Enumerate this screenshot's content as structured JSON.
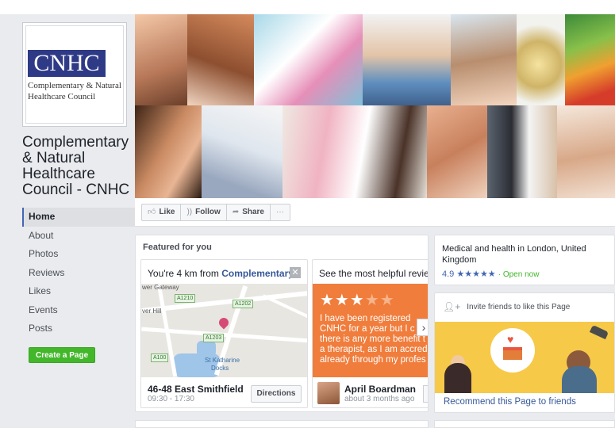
{
  "page": {
    "logo_text": "CNHC",
    "logo_subtitle": "Complementary & Natural\nHealthcare Council",
    "name": "Complementary\n& Natural\nHealthcare\nCouncil - CNHC"
  },
  "nav": {
    "items": [
      "Home",
      "About",
      "Photos",
      "Reviews",
      "Likes",
      "Events",
      "Posts"
    ],
    "create_page": "Create a Page"
  },
  "actions": {
    "like": "Like",
    "follow": "Follow",
    "share": "Share",
    "more": "···"
  },
  "featured": {
    "title": "Featured for you",
    "location": {
      "heading_prefix": "You're 4 km from ",
      "heading_bold": "Complementary...",
      "address": "46-48 East Smithfield",
      "hours": "09:30 - 17:30",
      "button": "Directions",
      "map_labels": {
        "gateway": "wer Gateway",
        "hill": "ver Hill",
        "dock1": "St Katharine",
        "dock2": "Docks",
        "r1": "A1210",
        "r2": "A1202",
        "r3": "A1203",
        "r4": "A100"
      }
    },
    "review": {
      "heading": "See the most helpful reviews o",
      "rating": 3,
      "max_rating": 5,
      "text": "I have been registered\nCNHC for a year but I c\nthere is any more benefit t\na therapist, as I am accred\nalready through my profes",
      "author": "April Boardman",
      "time": "about 3 months ago"
    }
  },
  "info": {
    "category": "Medical and health in London, United Kingdom",
    "rating": "4.9",
    "stars": "★★★★★",
    "status": "· Open now"
  },
  "invite": {
    "heading": "Invite friends to like this Page",
    "link": "Recommend this Page to friends"
  },
  "colors": {
    "accent": "#4267b2",
    "review_bg": "#f07d3c",
    "create_btn": "#42b72a",
    "illustration_bg": "#f7c948"
  },
  "icons": {
    "like": "thumbs-up-icon",
    "follow": "rss-icon",
    "share": "share-arrow-icon",
    "close": "close-icon",
    "next": "chevron-right-icon",
    "invite": "add-person-icon"
  }
}
